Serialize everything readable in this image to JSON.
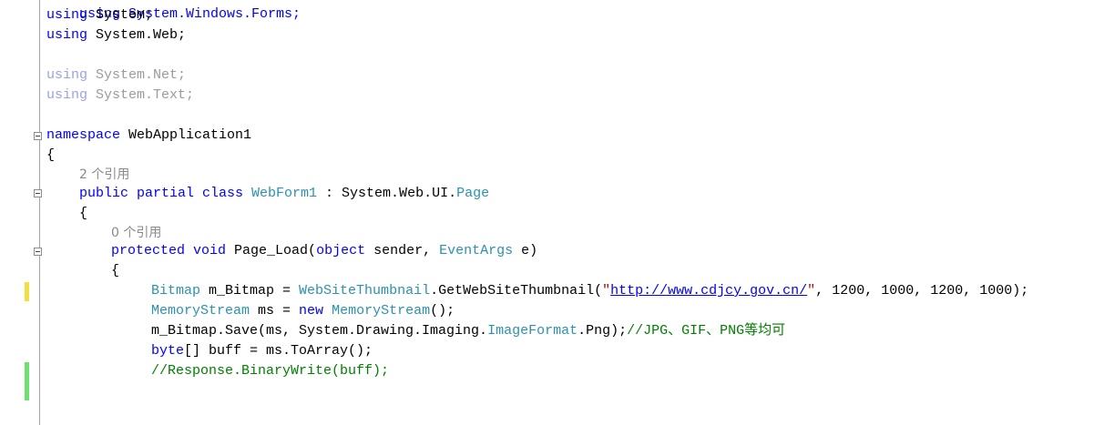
{
  "editor": {
    "colors": {
      "keyword": "#0000ff",
      "type": "#2b91af",
      "comment": "#008000",
      "string": "#a31515",
      "unused_using": "#9b9b9b",
      "change_saved": "#6ee06e",
      "change_unsaved": "#f0e040"
    },
    "lines": {
      "partial_top": "using System.Windows.Forms;",
      "using_system_kw": "using",
      "using_system_ns": " System;",
      "using_web_kw": "using",
      "using_web_ns": " System.Web;",
      "using_net_kw": "using",
      "using_net_ns": " System.Net;",
      "using_text_kw": "using",
      "using_text_ns": " System.Text;",
      "namespace_kw": "namespace",
      "namespace_name": " WebApplication1",
      "open_brace_ns": "{",
      "class_refs": "2 个引用",
      "class_mods": "public partial class ",
      "class_name": "WebForm1",
      "class_base_prefix": " : System.Web.UI.",
      "class_base": "Page",
      "open_brace_class": "{",
      "method_refs": "0 个引用",
      "method_mods": "protected void",
      "method_name": " Page_Load(",
      "param_kw": "object",
      "param_rest": " sender, ",
      "param_type": "EventArgs",
      "param_end": " e)",
      "open_brace_method": "{",
      "l1_type": "Bitmap",
      "l1_var": " m_Bitmap = ",
      "l1_class": "WebSiteThumbnail",
      "l1_call": ".GetWebSiteThumbnail(",
      "l1_quote_open": "\"",
      "l1_url": "http://www.cdjcy.gov.cn/",
      "l1_quote_close": "\"",
      "l1_args": ", 1200, 1000, 1200, 1000);",
      "l2_type": "MemoryStream",
      "l2_var": " ms = ",
      "l2_new": "new",
      "l2_sp": " ",
      "l2_ctor": "MemoryStream",
      "l2_end": "();",
      "l3_call": "m_Bitmap.Save(ms, System.Drawing.Imaging.",
      "l3_enum": "ImageFormat",
      "l3_end": ".Png);",
      "l3_comment": "//JPG、GIF、PNG等均可",
      "l4_kw": "byte",
      "l4_rest": "[] buff = ms.ToArray();",
      "l5_comment": "//Response.BinaryWrite(buff);"
    }
  }
}
